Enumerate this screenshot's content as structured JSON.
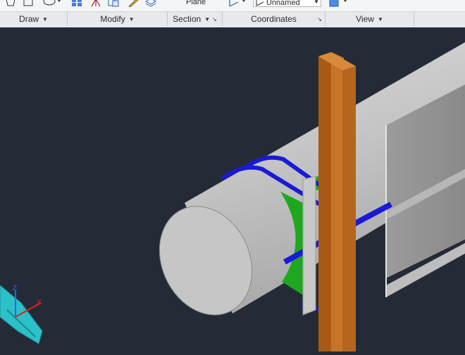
{
  "ribbon": {
    "panels": [
      {
        "label": "Draw",
        "has_expander": true
      },
      {
        "label": "Modify",
        "has_expander": true
      },
      {
        "label": "Section",
        "has_expander": true
      },
      {
        "label": "Coordinates",
        "has_expander": false
      },
      {
        "label": "View",
        "has_expander": true
      }
    ],
    "section_plane_label": "Plane",
    "coordinates_ucs_combo": "Unnamed",
    "icons": [
      "polygon-icon",
      "rectangle-icon",
      "ellipse-icon",
      "array-icon",
      "mirror-icon",
      "copy-icon",
      "pencil-edit-icon",
      "layer-icon",
      "ucs-icon",
      "view-cube-icon"
    ]
  },
  "viewport": {
    "background": "#242b36",
    "objects": [
      "cylinder-pipe",
      "steel-i-beam-column",
      "support-plate",
      "green-saddle-pad",
      "blue-u-bolt",
      "ribbed-panel-wall",
      "ucs-axis-icon"
    ],
    "axis_labels": [
      "Z",
      "X"
    ]
  },
  "colors": {
    "beam": "#b5651d",
    "bolt": "#1a1ad6",
    "pad": "#1fa81f",
    "pipe": "#c9c9c9"
  }
}
